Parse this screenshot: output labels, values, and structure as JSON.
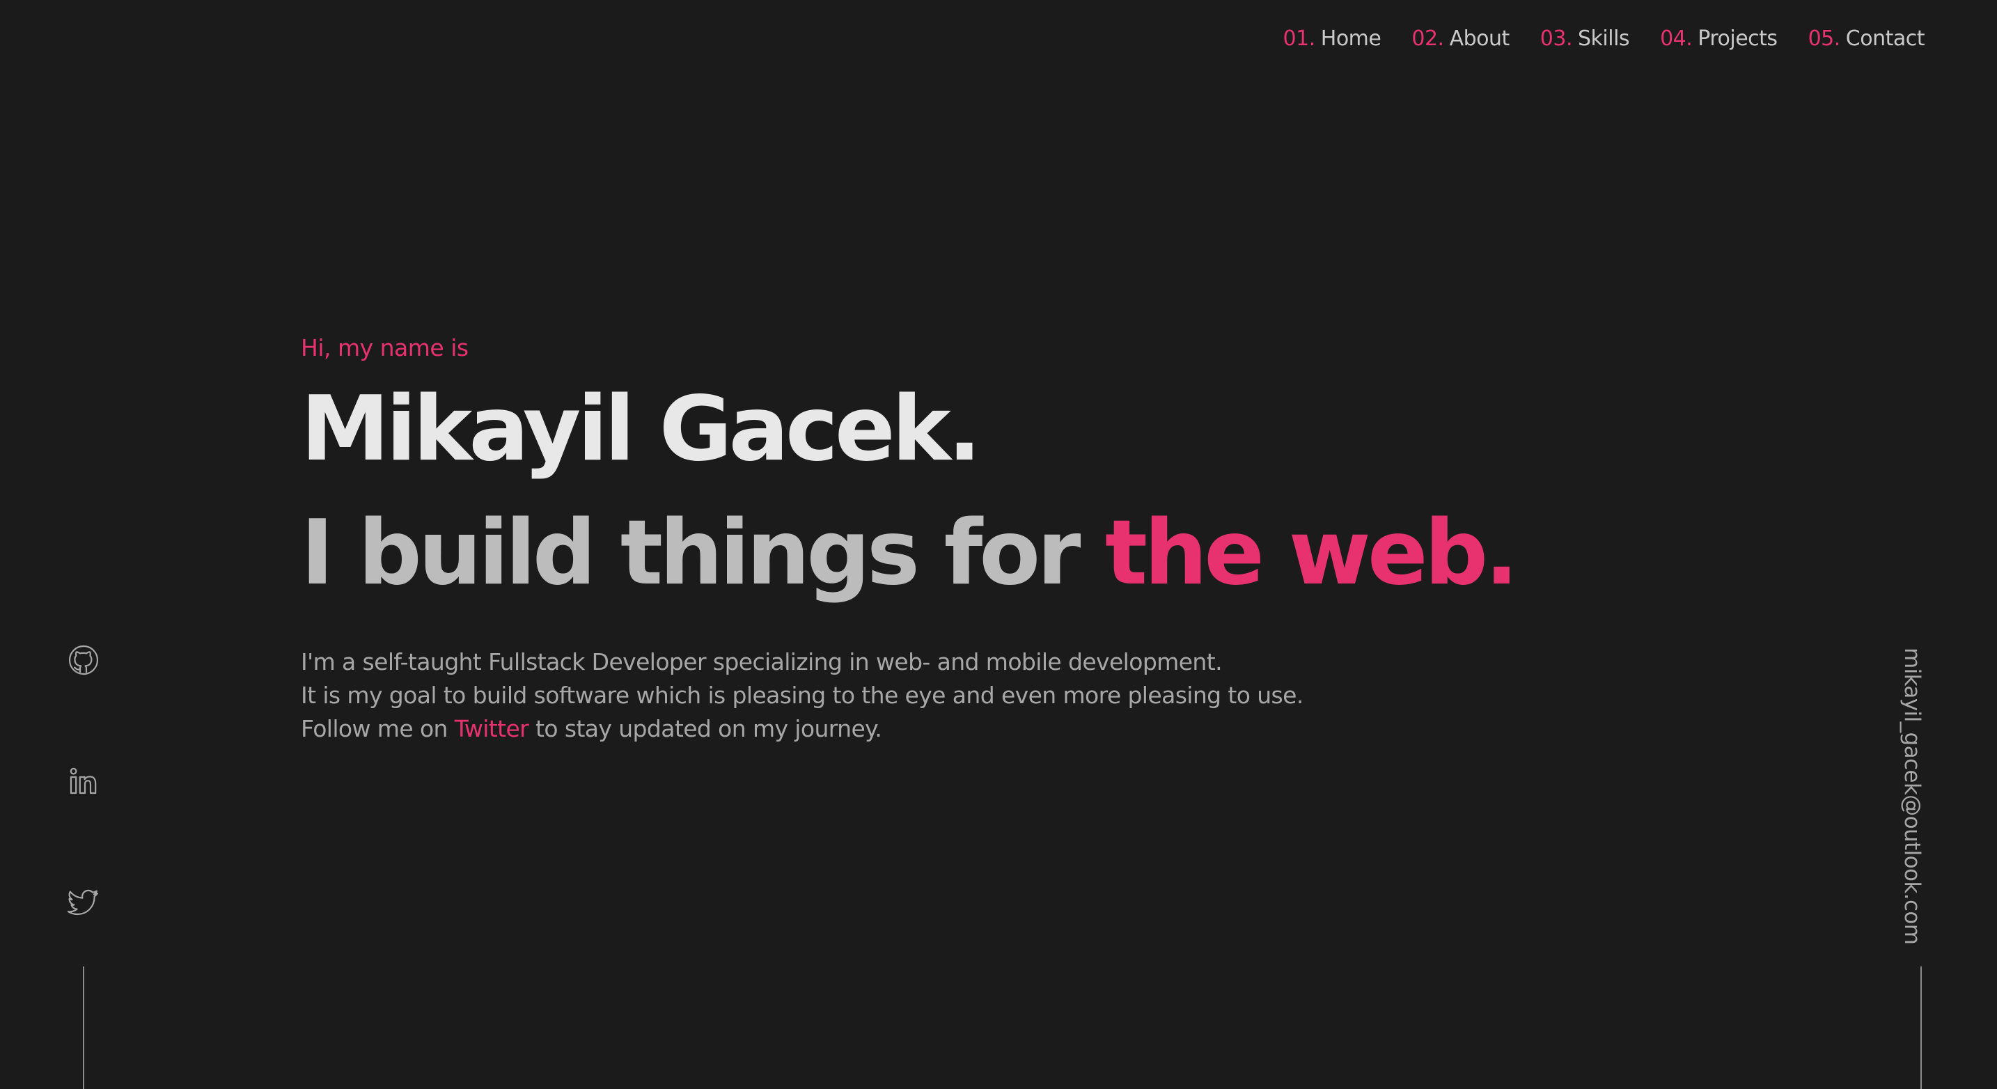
{
  "nav": {
    "items": [
      {
        "num": "01.",
        "label": "Home"
      },
      {
        "num": "02.",
        "label": "About"
      },
      {
        "num": "03.",
        "label": "Skills"
      },
      {
        "num": "04.",
        "label": "Projects"
      },
      {
        "num": "05.",
        "label": "Contact"
      }
    ]
  },
  "hero": {
    "intro": "Hi, my name is",
    "name": "Mikayil Gacek.",
    "tagline_prefix": "I build things for ",
    "tagline_accent": "the web.",
    "description": {
      "line1": "I'm a self-taught Fullstack Developer specializing in web- and mobile development.",
      "line2": "It is my goal to build software which is pleasing to the eye and even more pleasing to use.",
      "line3_prefix": "Follow me on ",
      "line3_link": "Twitter",
      "line3_suffix": " to stay updated on my journey."
    }
  },
  "social": {
    "items": [
      {
        "icon": "github-icon"
      },
      {
        "icon": "linkedin-icon"
      },
      {
        "icon": "twitter-icon"
      }
    ]
  },
  "email": "mikayil_gacek@outlook.com",
  "colors": {
    "accent": "#e8326f",
    "background": "#1b1b1c",
    "text": "#a7a7a7"
  }
}
